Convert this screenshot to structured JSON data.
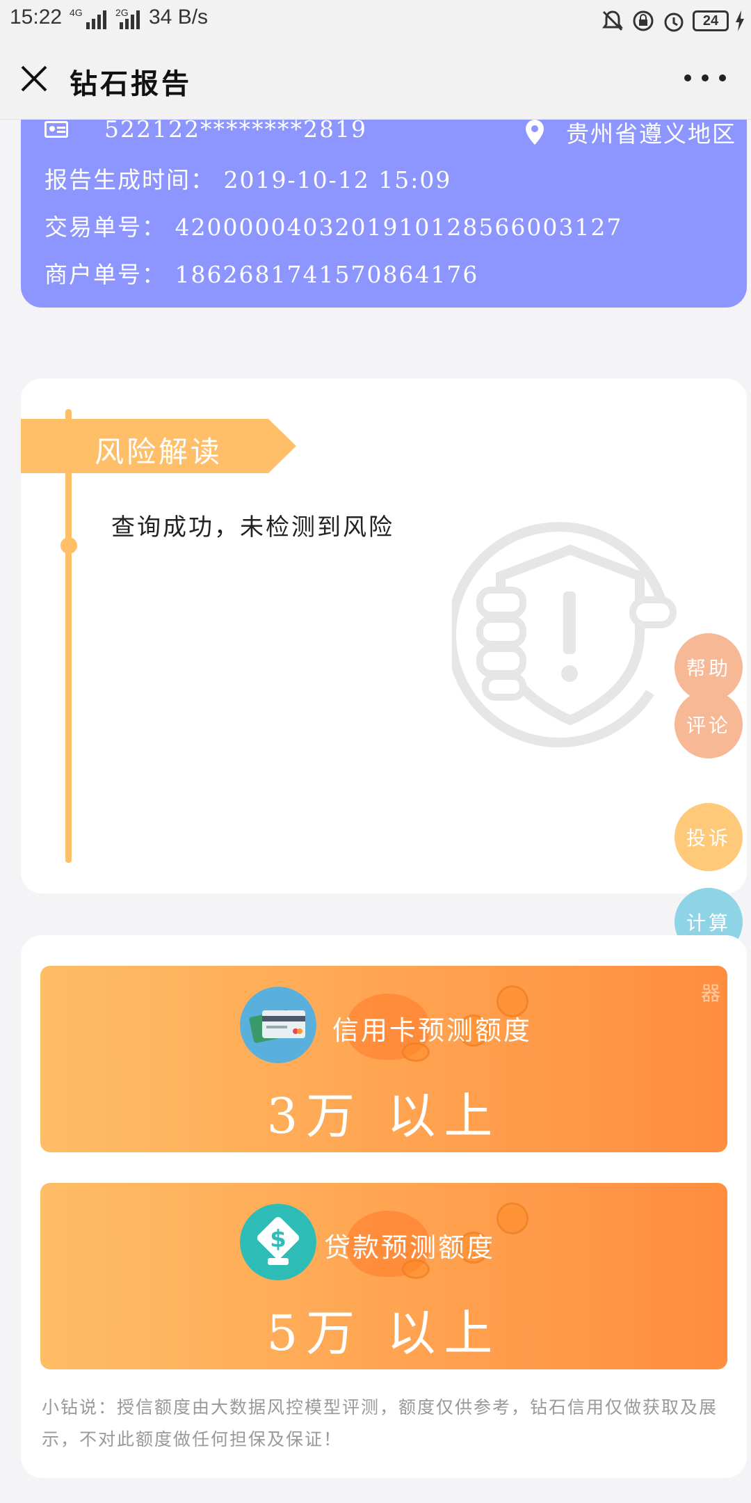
{
  "status_bar": {
    "time": "15:22",
    "signal_1": "4G",
    "signal_2": "2G",
    "net_speed": "34 B/s",
    "battery": "24"
  },
  "nav": {
    "title": "钻石报告",
    "close_icon": "close-icon",
    "more_icon": "more-icon"
  },
  "info": {
    "id_number": "522122********2819",
    "region": "贵州省遵义地区",
    "report_time_label": "报告生成时间：",
    "report_time_value": "2019-10-12 15:09",
    "trade_no_label": "交易单号：",
    "trade_no_value": "4200000403201910128566003127",
    "merchant_no_label": "商户单号：",
    "merchant_no_value": "18626817415708641​76"
  },
  "risk": {
    "banner": "风险解读",
    "text": "查询成功，未检测到风险"
  },
  "float_buttons": [
    {
      "label": "帮助",
      "color": "#f7b896"
    },
    {
      "label": "评论",
      "color": "#f7b896"
    },
    {
      "label": "投诉",
      "color": "#ffc97a"
    },
    {
      "label": "计算",
      "color": "#8fd3e6"
    }
  ],
  "quota": {
    "credit_card_label": "信用卡预测额度",
    "credit_card_value": "3万 以上",
    "loan_label": "贷款预测额度",
    "loan_value": "5万 以上",
    "corner_text": "器",
    "note": "小钻说：授信额度由大数据风控模型评测，额度仅供参考，钻石信用仅做获取及展示，不对此额度做任何担保及保证！"
  },
  "colors": {
    "purple": "#8d95ff",
    "orange": "#ffbe68",
    "gradient_start": "#ffbd66",
    "gradient_end": "#ff8d3e"
  }
}
